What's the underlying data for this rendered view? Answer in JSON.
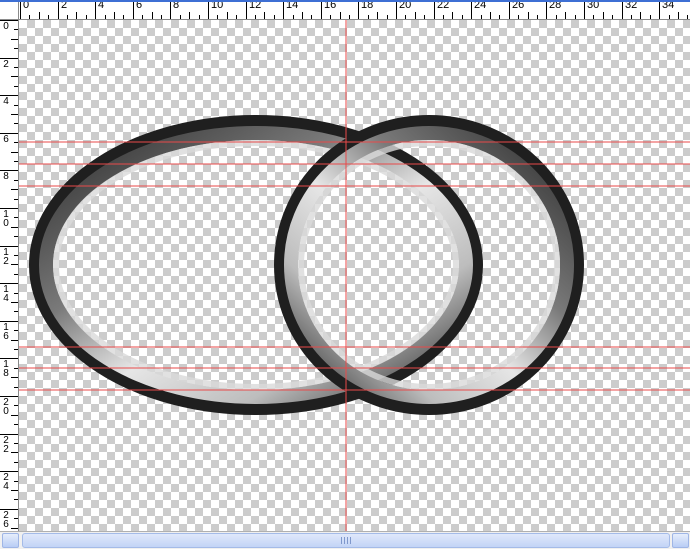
{
  "rulers": {
    "horizontal_labels": [
      "0",
      "2",
      "4",
      "6",
      "8",
      "10",
      "12",
      "14",
      "16",
      "18",
      "20",
      "22",
      "24",
      "26",
      "28",
      "30",
      "32",
      "34"
    ],
    "vertical_labels": [
      "0",
      "2",
      "4",
      "6",
      "8",
      "10",
      "12",
      "14",
      "16",
      "18",
      "20",
      "22",
      "24",
      "26"
    ],
    "units": "cm"
  },
  "document": {
    "background": "transparency-checkerboard",
    "artwork": "two-interlocking-rings",
    "guide_color": "#e84a4a"
  },
  "icons": {
    "scroll_left": "arrow-left-icon",
    "scroll_right": "arrow-right-icon"
  }
}
